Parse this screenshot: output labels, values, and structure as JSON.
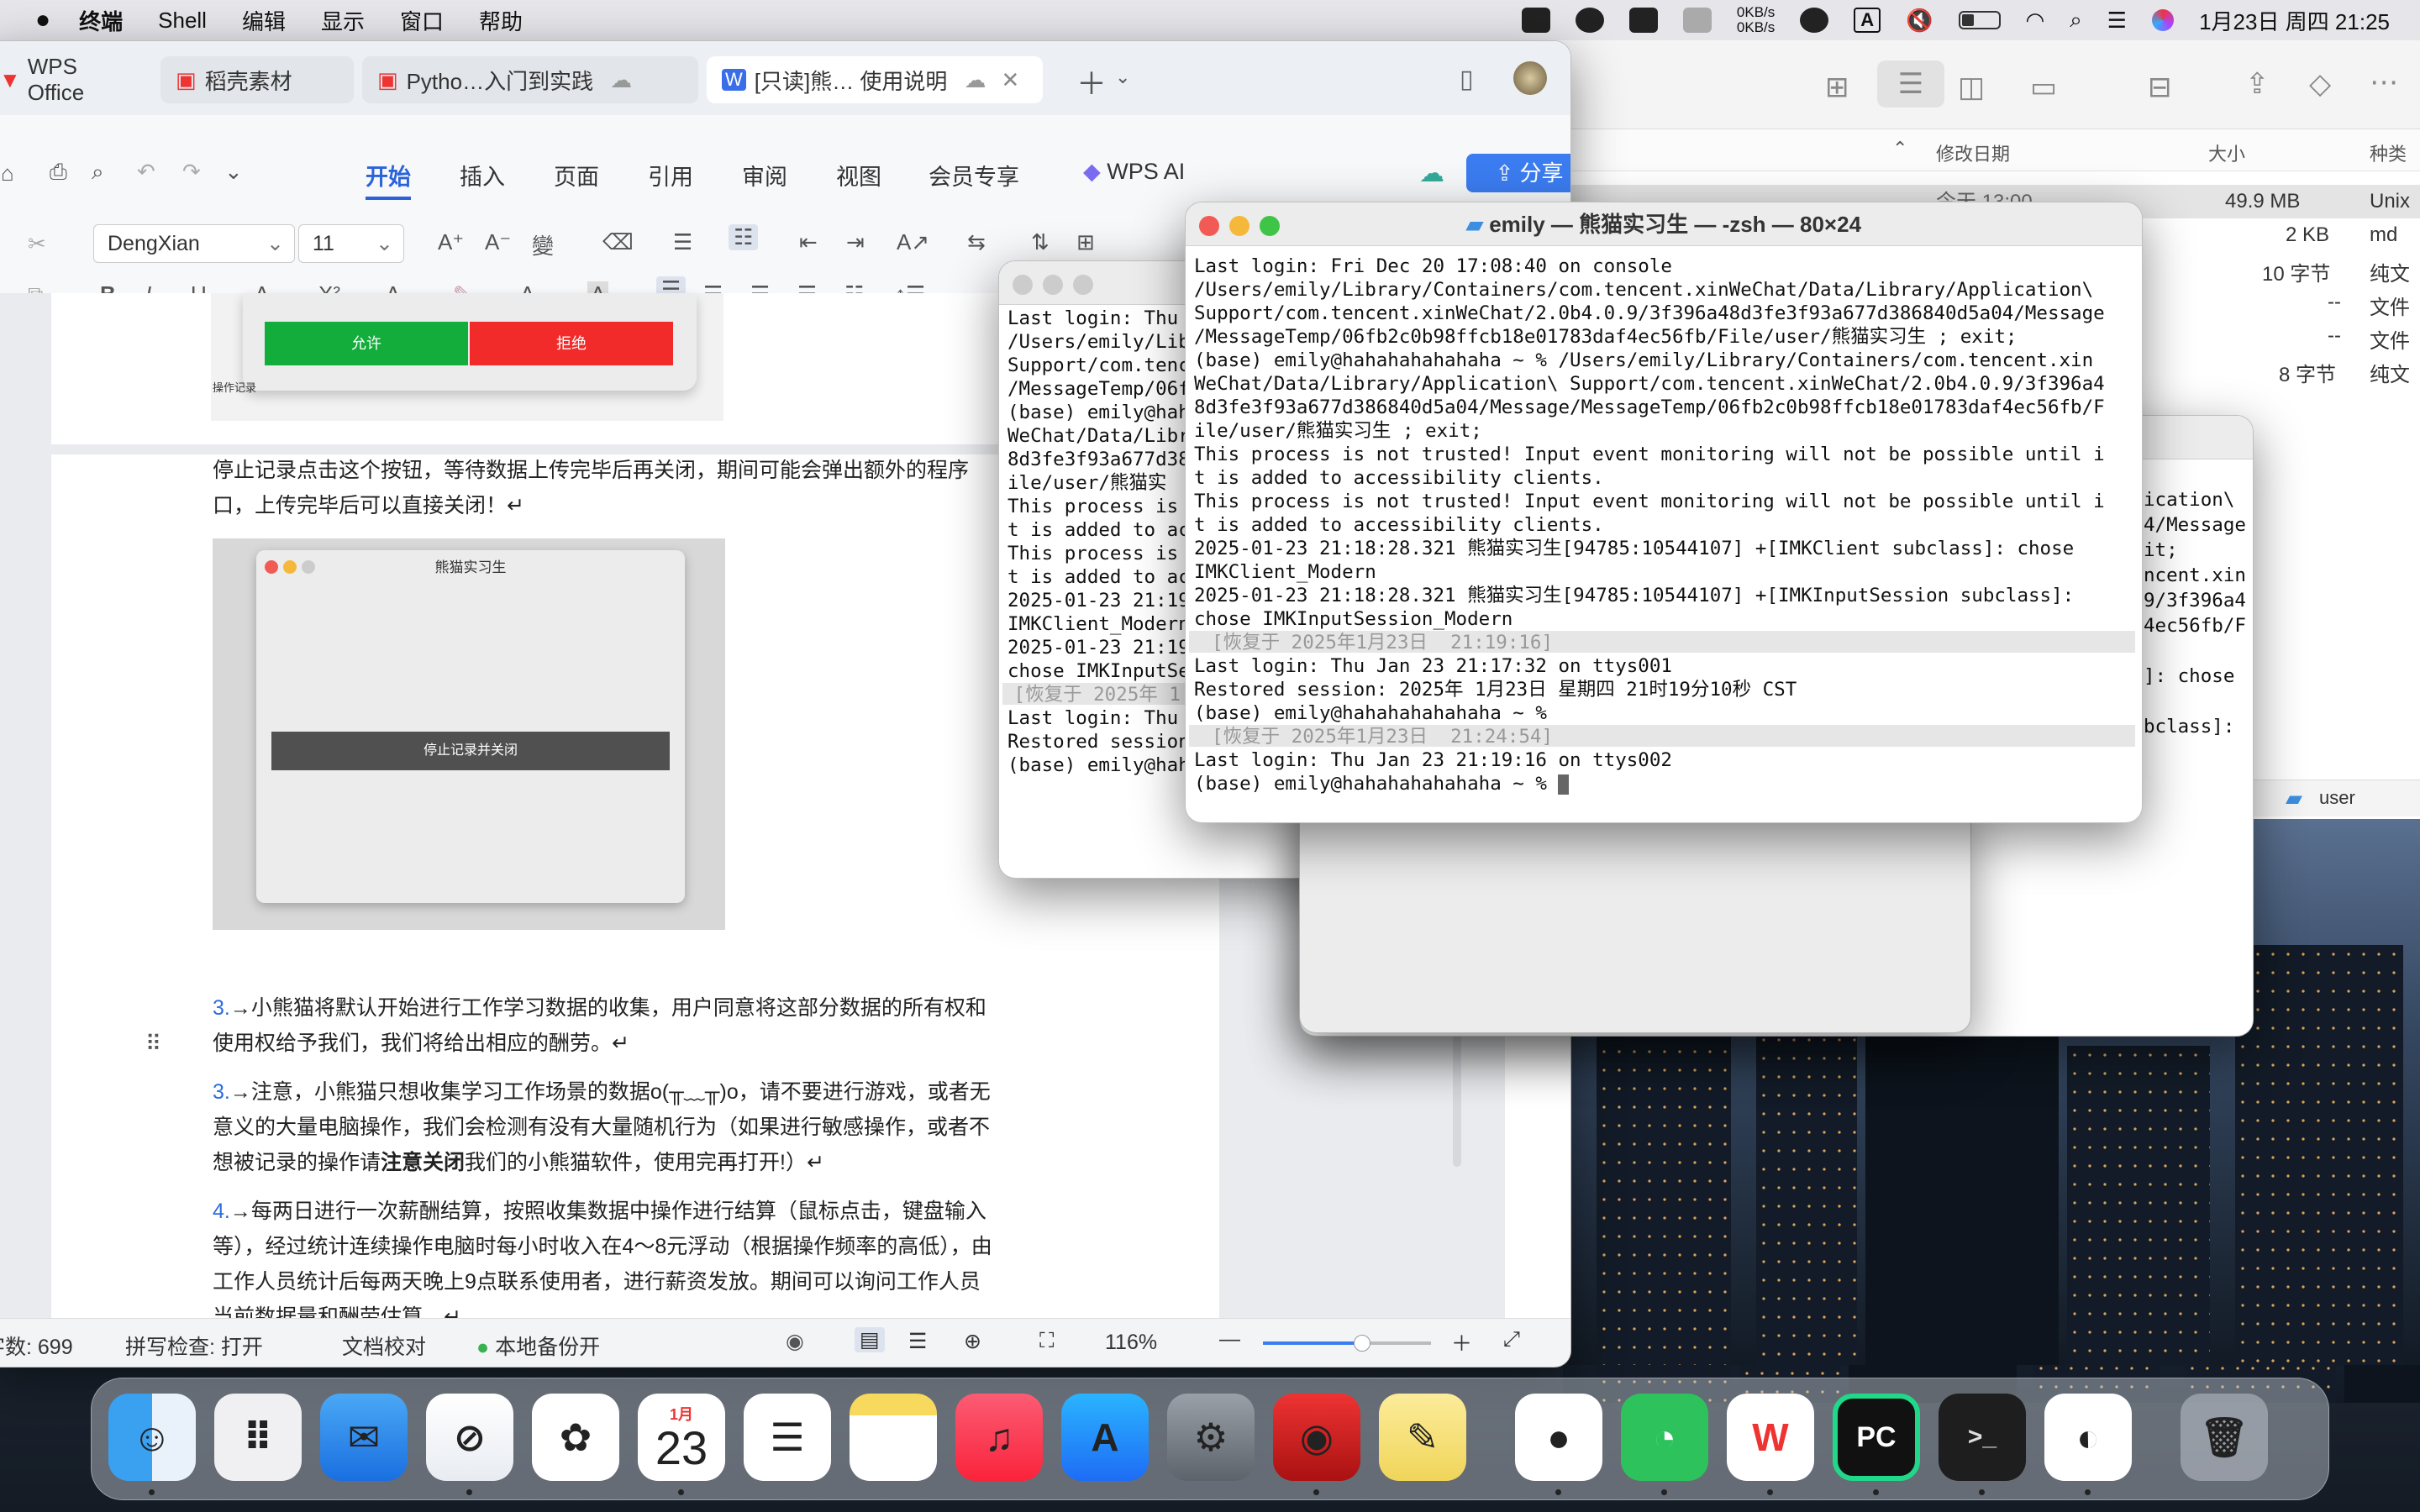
{
  "menubar": {
    "app": "终端",
    "items": [
      "Shell",
      "编辑",
      "显示",
      "窗口",
      "帮助"
    ],
    "net_up": "0KB/s",
    "net_down": "0KB/s",
    "ime": "A",
    "datetime": "1月23日 周四  21:25"
  },
  "finder": {
    "columns": {
      "date": "修改日期",
      "size": "大小",
      "kind": "种类"
    },
    "rows": [
      {
        "date": "今天 13:00",
        "size": "49.9 MB",
        "kind": "Unix"
      },
      {
        "size": "2 KB",
        "kind": "md"
      },
      {
        "size": "10 字节",
        "kind": "纯文"
      },
      {
        "size": "--",
        "kind": "文件"
      },
      {
        "size": "--",
        "kind": "文件"
      },
      {
        "size": "8 字节",
        "kind": "纯文"
      }
    ],
    "path": "user"
  },
  "wps": {
    "tabs": [
      "WPS Office",
      "稻壳素材",
      "Pytho…入门到实践",
      "[只读]熊… 使用说明"
    ],
    "ribbon_tabs": [
      "开始",
      "插入",
      "页面",
      "引用",
      "审阅",
      "视图",
      "会员专享"
    ],
    "ai": "WPS AI",
    "share": "分享",
    "font": "DengXian",
    "size": "11",
    "doc": {
      "btn_allow": "允许",
      "btn_deny": "拒绝",
      "caption": "操作记录",
      "p1a": "停止记录点击这个按钮，等待数据上传完毕后再关闭，期间可能会弹出额外的程序",
      "p1b": "口，上传完毕后可以直接关闭！↵",
      "dialog_title": "熊猫实习生",
      "dialog_btn": "停止记录并关闭",
      "n3": "3.",
      "p3a": "→小熊猫将默认开始进行工作学习数据的收集，用户同意将这部分数据的所有权和",
      "p3b": "使用权给予我们，我们将给出相应的酬劳。↵",
      "n3b": "3.",
      "p4a": "→注意，小熊猫只想收集学习工作场景的数据o(╥﹏╥)o，请不要进行游戏，或者无",
      "p4b": "意义的大量电脑操作，我们会检测有没有大量随机行为（如果进行敏感操作，或者不",
      "p4c1": "想被记录的操作请",
      "p4c2": "注意关闭",
      "p4c3": "我们的小熊猫软件，使用完再打开!）↵",
      "n4": "4.",
      "p5a": "→每两日进行一次薪酬结算，按照收集数据中操作进行结算（鼠标点击，键盘输入",
      "p5b": "等），经过统计连续操作电脑时每小时收入在4～8元浮动（根据操作频率的高低），由",
      "p5c": "工作人员统计后每两天晚上9点联系使用者，进行薪资发放。期间可以询问工作人员",
      "p5d": "当前数据量和酬劳估算。↵"
    },
    "status": {
      "words": "字数: 699",
      "spell": "拼写检查: 打开",
      "proof": "文档校对",
      "backup": "本地备份开",
      "zoom": "116%"
    }
  },
  "terminal_back": {
    "lines": [
      "Last login: Thu",
      "/Users/emily/Lib",
      "Support/com.tenc",
      "/MessageTemp/06f",
      "(base) emily@hah",
      "WeChat/Data/Libr",
      "8d3fe3f93a677d38",
      "ile/user/熊猫实",
      "This process is ",
      "t is added to ac",
      "This process is ",
      "t is added to ac",
      "2025-01-23 21:19",
      "IMKClient_Modern",
      "2025-01-23 21:19",
      "chose IMKInputSe"
    ],
    "restore": " [恢复于 2025年 1",
    "lines2": [
      "Last login: Thu",
      "Restored session",
      "(base) emily@hah"
    ]
  },
  "terminal_mid": {
    "lines": [
      "ication\\",
      "4/Message",
      "it;",
      "ncent.xin",
      "9/3f396a4",
      "4ec56fb/F",
      "]: chose",
      "bclass]:"
    ]
  },
  "terminal": {
    "title": "emily — 熊猫实习生 — -zsh — 80×24",
    "lines": [
      "Last login: Fri Dec 20 17:08:40 on console",
      "/Users/emily/Library/Containers/com.tencent.xinWeChat/Data/Library/Application\\",
      "Support/com.tencent.xinWeChat/2.0b4.0.9/3f396a48d3fe3f93a677d386840d5a04/Message",
      "/MessageTemp/06fb2c0b98ffcb18e01783daf4ec56fb/File/user/熊猫实习生 ; exit;",
      "(base) emily@hahahahahahaha ~ % /Users/emily/Library/Containers/com.tencent.xin",
      "WeChat/Data/Library/Application\\ Support/com.tencent.xinWeChat/2.0b4.0.9/3f396a4",
      "8d3fe3f93a677d386840d5a04/Message/MessageTemp/06fb2c0b98ffcb18e01783daf4ec56fb/F",
      "ile/user/熊猫实习生 ; exit;",
      "This process is not trusted! Input event monitoring will not be possible until i",
      "t is added to accessibility clients.",
      "This process is not trusted! Input event monitoring will not be possible until i",
      "t is added to accessibility clients.",
      "2025-01-23 21:18:28.321 熊猫实习生[94785:10544107] +[IMKClient subclass]: chose",
      "IMKClient_Modern",
      "2025-01-23 21:18:28.321 熊猫实习生[94785:10544107] +[IMKInputSession subclass]:",
      "chose IMKInputSession_Modern"
    ],
    "restore1": "  [恢复于 2025年1月23日  21:19:16]",
    "lines2": [
      "Last login: Thu Jan 23 21:17:32 on ttys001",
      "Restored session: 2025年 1月23日 星期四 21时19分10秒 CST",
      "(base) emily@hahahahahahaha ~ %"
    ],
    "restore2": "  [恢复于 2025年1月23日  21:24:54]",
    "lines3": [
      "Last login: Thu Jan 23 21:19:16 on ttys002",
      "(base) emily@hahahahahahaha ~ % "
    ]
  },
  "dock": {
    "calendar_month": "1月",
    "calendar_day": "23",
    "apps": [
      "finder-icon",
      "launchpad-icon",
      "mail-icon",
      "safari-icon",
      "photos-icon",
      "calendar-icon",
      "reminders-icon",
      "notes-icon",
      "music-icon",
      "appstore-icon",
      "settings-icon",
      "photobooth-icon",
      "stickies-icon",
      "qq-icon",
      "wechat-icon",
      "wps-icon",
      "pycharm-icon",
      "terminal-icon",
      "panda-icon",
      "trash-icon"
    ]
  }
}
